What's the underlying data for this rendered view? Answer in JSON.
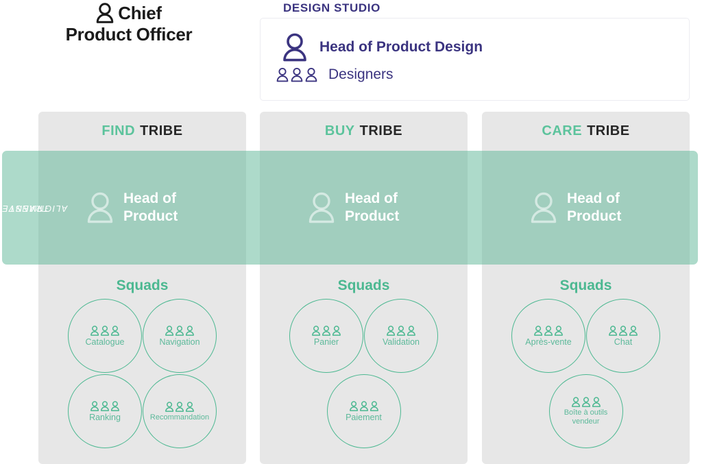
{
  "cpo": {
    "line1": "Chief",
    "line2": "Product Officer",
    "icon": "person-icon"
  },
  "design_studio": {
    "title": "DESIGN STUDIO",
    "head_label": "Head of Product Design",
    "head_icon": "person-icon",
    "designers_label": "Designers",
    "designers_icon": "three-people-icon",
    "color": "#3b3480"
  },
  "transverse": {
    "line1": "TRANSVERSE",
    "line2": "ALIGNMENT",
    "band_color": "#62b99a"
  },
  "colors": {
    "green": "#4cb891",
    "green_light": "#5cc39c",
    "purple": "#3b3480",
    "column_gray": "#e7e7e7",
    "dark": "#272727"
  },
  "tribes": [
    {
      "keyword": "FIND",
      "suffix": "TRIBE",
      "head_of_product": {
        "line1": "Head of",
        "line2": "Product",
        "icon": "person-icon"
      },
      "squads_title": "Squads",
      "squads": [
        {
          "label": "Catalogue",
          "icon": "three-people-icon"
        },
        {
          "label": "Navigation",
          "icon": "three-people-icon"
        },
        {
          "label": "Ranking",
          "icon": "three-people-icon"
        },
        {
          "label": "Recommandation",
          "icon": "three-people-icon",
          "small": true
        }
      ]
    },
    {
      "keyword": "BUY",
      "suffix": "TRIBE",
      "head_of_product": {
        "line1": "Head of",
        "line2": "Product",
        "icon": "person-icon"
      },
      "squads_title": "Squads",
      "squads": [
        {
          "label": "Panier",
          "icon": "three-people-icon"
        },
        {
          "label": "Validation",
          "icon": "three-people-icon"
        },
        {
          "label": "Paiement",
          "icon": "three-people-icon"
        }
      ]
    },
    {
      "keyword": "CARE",
      "suffix": "TRIBE",
      "head_of_product": {
        "line1": "Head of",
        "line2": "Product",
        "icon": "person-icon"
      },
      "squads_title": "Squads",
      "squads": [
        {
          "label": "Après-vente",
          "icon": "three-people-icon"
        },
        {
          "label": "Chat",
          "icon": "three-people-icon"
        },
        {
          "label": "Boîte à outils vendeur",
          "icon": "three-people-icon",
          "small": true
        }
      ]
    }
  ]
}
